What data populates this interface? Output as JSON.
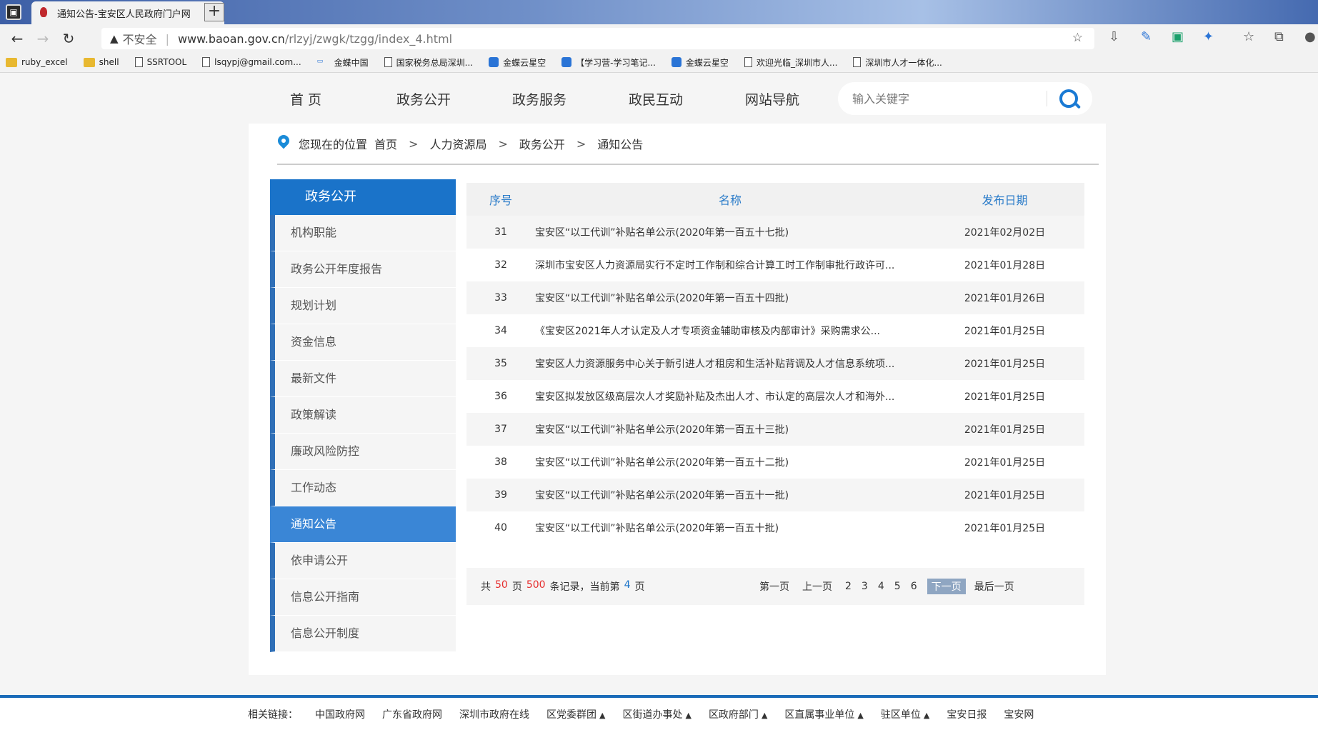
{
  "browser": {
    "tab_title": "通知公告-宝安区人民政府门户网",
    "tab_close": "×",
    "new_tab": "+",
    "insecure_label": "不安全",
    "url_host": "www.baoan.gov.cn",
    "url_path": "/rlzyj/zwgk/tzgg/index_4.html",
    "bookmarks": [
      "ruby_excel",
      "shell",
      "SSRTOOL",
      "lsqypj@gmail.com...",
      "金蝶中国",
      "国家税务总局深圳...",
      "金蝶云星空",
      "【学习营-学习笔记...",
      "金蝶云星空",
      "欢迎光临_深圳市人...",
      "深圳市人才一体化..."
    ]
  },
  "nav": {
    "items": [
      "首 页",
      "政务公开",
      "政务服务",
      "政民互动",
      "网站导航"
    ],
    "search_placeholder": "输入关键字"
  },
  "breadcrumb": {
    "location_label": "您现在的位置",
    "items": [
      "首页",
      "人力资源局",
      "政务公开",
      "通知公告"
    ],
    "separator": ">"
  },
  "sidebar": {
    "title": "政务公开",
    "items": [
      "机构职能",
      "政务公开年度报告",
      "规划计划",
      "资金信息",
      "最新文件",
      "政策解读",
      "廉政风险防控",
      "工作动态",
      "通知公告",
      "依申请公开",
      "信息公开指南",
      "信息公开制度"
    ],
    "active": "通知公告"
  },
  "list": {
    "headers": [
      "序号",
      "名称",
      "发布日期"
    ],
    "rows": [
      {
        "no": "31",
        "name": "宝安区“以工代训”补贴名单公示(2020年第一百五十七批)",
        "date": "2021年02月02日"
      },
      {
        "no": "32",
        "name": "深圳市宝安区人力资源局实行不定时工作制和综合计算工时工作制审批行政许可...",
        "date": "2021年01月28日"
      },
      {
        "no": "33",
        "name": "宝安区“以工代训”补贴名单公示(2020年第一百五十四批)",
        "date": "2021年01月26日"
      },
      {
        "no": "34",
        "name": "《宝安区2021年人才认定及人才专项资金辅助审核及内部审计》采购需求公...",
        "date": "2021年01月25日"
      },
      {
        "no": "35",
        "name": "宝安区人力资源服务中心关于新引进人才租房和生活补贴背调及人才信息系统项...",
        "date": "2021年01月25日"
      },
      {
        "no": "36",
        "name": "宝安区拟发放区级高层次人才奖励补贴及杰出人才、市认定的高层次人才和海外...",
        "date": "2021年01月25日"
      },
      {
        "no": "37",
        "name": "宝安区“以工代训”补贴名单公示(2020年第一百五十三批)",
        "date": "2021年01月25日"
      },
      {
        "no": "38",
        "name": "宝安区“以工代训”补贴名单公示(2020年第一百五十二批)",
        "date": "2021年01月25日"
      },
      {
        "no": "39",
        "name": "宝安区“以工代训”补贴名单公示(2020年第一百五十一批)",
        "date": "2021年01月25日"
      },
      {
        "no": "40",
        "name": "宝安区“以工代训”补贴名单公示(2020年第一百五十批)",
        "date": "2021年01月25日"
      }
    ]
  },
  "pager": {
    "t1": "共",
    "total_pages": "50",
    "t2": "页",
    "total_records": "500",
    "t3": "条记录，当前第",
    "current": "4",
    "t4": "页",
    "first": "第一页",
    "prev": "上一页",
    "pages": [
      "2",
      "3",
      "4",
      "5",
      "6"
    ],
    "next": "下一页",
    "last": "最后一页"
  },
  "footer": {
    "label": "相关链接：",
    "links": [
      "中国政府网",
      "广东省政府网",
      "深圳市政府在线"
    ],
    "dropdowns": [
      "区党委群团",
      "区街道办事处",
      "区政府部门",
      "区直属事业单位",
      "驻区单位"
    ],
    "tail_links": [
      "宝安日报",
      "宝安网"
    ],
    "arrow": "▲"
  },
  "colors": {
    "accent": "#1a73c9",
    "active_side": "#3a86d6",
    "red": "#e62d2d"
  }
}
